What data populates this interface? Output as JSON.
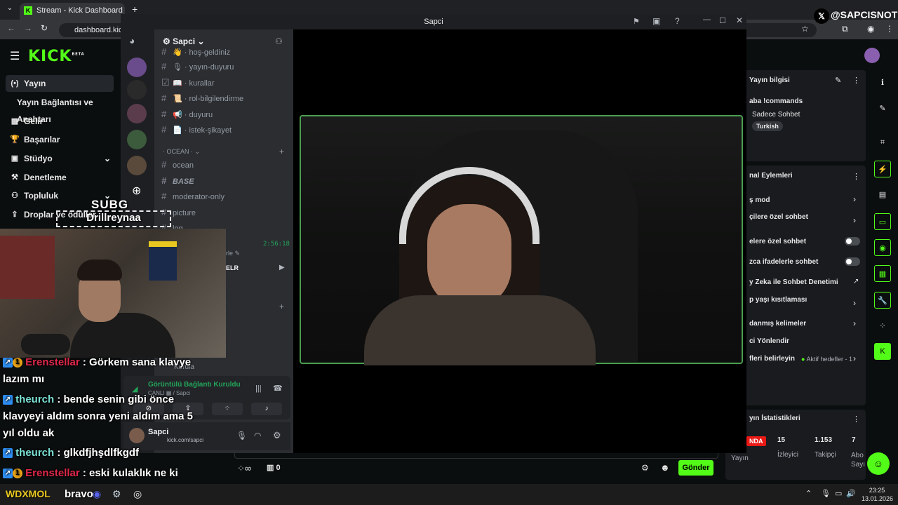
{
  "browser": {
    "tab_title": "Stream - Kick Dashboard",
    "tab_favicon": "K",
    "url": "dashboard.kick.co"
  },
  "watermark": "@SAPCISNOT",
  "kick": {
    "logo": "KICK",
    "logo_beta": "BETA",
    "nav": [
      {
        "label": "Yayın",
        "icon": "(•)"
      },
      {
        "label": "Yayın Bağlantısı ve Anahtarı",
        "icon": ""
      },
      {
        "label": "Gelir",
        "icon": "▦"
      },
      {
        "label": "Başarılar",
        "icon": "🏆"
      },
      {
        "label": "Stüdyo",
        "icon": "▣"
      },
      {
        "label": "Denetleme",
        "icon": "⚒"
      },
      {
        "label": "Topluluk",
        "icon": "⚇"
      },
      {
        "label": "Droplar ve ödüller",
        "icon": "⇪"
      }
    ],
    "stream_info": {
      "title": "Yayın bilgisi",
      "line1": "aba !commands",
      "line2": "Sadece Sohbet",
      "tag": "Turkish"
    },
    "channel_actions": {
      "title": "nal Eylemleri",
      "items": [
        {
          "label": "ş mod",
          "control": "chevron"
        },
        {
          "label": "çilere özel sohbet",
          "control": "chevron"
        },
        {
          "label": "elere özel sohbet",
          "control": "toggle"
        },
        {
          "label": "zca ifadelerle sohbet",
          "control": "toggle"
        },
        {
          "label": "y Zeka ile Sohbet Denetimi",
          "control": "external"
        },
        {
          "label": "p yaşı kısıtlaması",
          "control": "chevron"
        },
        {
          "label": "danmış kelimeler",
          "control": "chevron"
        },
        {
          "label": "ci Yönlendir",
          "control": "none"
        },
        {
          "label": "fleri belirleyin",
          "control": "chevron"
        }
      ],
      "goals_status": "Aktif hedefler - 1"
    },
    "stats": {
      "title": "yın İstatistikleri",
      "live_badge": "NDA",
      "values": [
        "15",
        "1.153",
        "7"
      ],
      "labels": [
        "Yayın",
        "İzleyici",
        "Takipçi",
        "Abo Sayı"
      ]
    },
    "chat_bar": {
      "infinity": "∞",
      "count": "0",
      "send_label": "Gönder"
    }
  },
  "discord": {
    "window_title": "Sapci",
    "server_name": "Sapci",
    "channels": [
      {
        "name": "hoş-geldiniz",
        "emoji": "👋"
      },
      {
        "name": "yayın-duyuru",
        "emoji": "🎙"
      },
      {
        "name": "kurallar",
        "emoji": "📖"
      },
      {
        "name": "rol-bilgilendirme",
        "emoji": "📜"
      },
      {
        "name": "duyuru",
        "emoji": "📢"
      },
      {
        "name": "istek-şikayet",
        "emoji": "📄"
      }
    ],
    "category": "OCEAN",
    "category_channels": [
      "ocean",
      "BASE",
      "moderator-only",
      "picture",
      "log"
    ],
    "voice_timer": "2:56:18",
    "voice_user_suffix": "rle",
    "voice_label": "ELR",
    "voice_channel_below": "Kurula",
    "connection_status": "Görüntülü Bağlantı Kuruldu",
    "connection_sub": "CANLI ▦ / Sapci",
    "user_name": "Sapci",
    "user_status": "kick.com/sapci"
  },
  "overlay": {
    "subg": "SUBG",
    "subg_name": "Drillreynaa",
    "chat": [
      {
        "user": "Erenstellar",
        "text": ": Görkem sana klavye",
        "user_color": "#e0284a"
      },
      {
        "user": "",
        "text": "lazım mı",
        "user_color": ""
      },
      {
        "user": "theurch",
        "text": ": bende senin gibi önce",
        "user_color": "#7be0d4"
      },
      {
        "user": "",
        "text": "klavyeyi aldım sonra yeni aldım ama 5",
        "user_color": ""
      },
      {
        "user": "",
        "text": "yıl oldu ak",
        "user_color": ""
      },
      {
        "user": "theurch",
        "text": ": glkdfjhşdlfkgdf",
        "user_color": "#7be0d4"
      },
      {
        "user": "Erenstellar",
        "text": ": eski kulaklık ne ki",
        "user_color": "#e0284a"
      }
    ],
    "bottom_text": "bravo",
    "bottom_prefix": "WDXMOL"
  },
  "taskbar": {
    "time": "23:25",
    "date": "13.01.2026"
  },
  "colors": {
    "kick_green": "#53fc18",
    "discord_bg": "#1e1f22",
    "discord_channels_bg": "#2b2d31",
    "video_border": "#4a9e51"
  }
}
